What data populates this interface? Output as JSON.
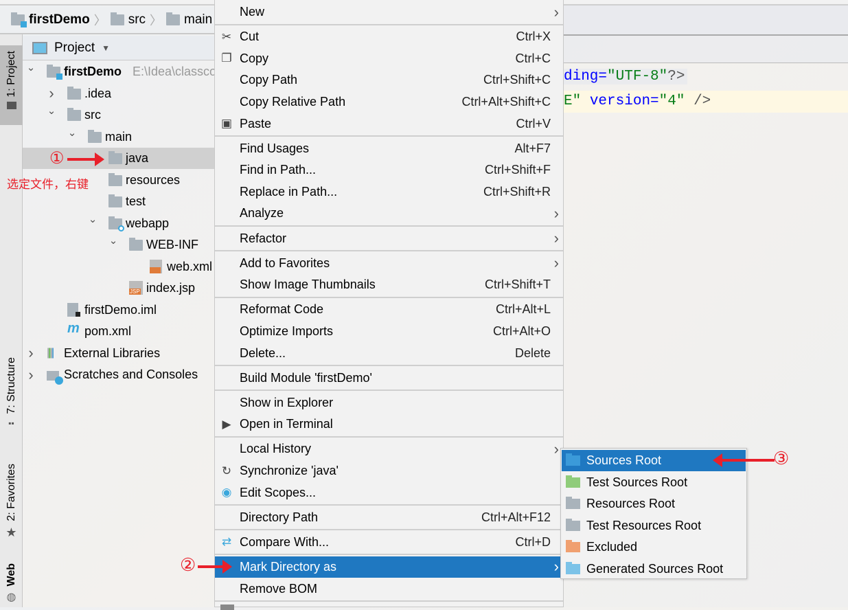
{
  "breadcrumb": {
    "items": [
      "firstDemo",
      "src",
      "main"
    ]
  },
  "tool_stripe": {
    "project": "1: Project",
    "structure": "7: Structure",
    "favorites": "2: Favorites",
    "web": "Web"
  },
  "project_panel": {
    "title": "Project",
    "tree": [
      {
        "label": "firstDemo",
        "hint": "E:\\Idea\\classco",
        "level": 0,
        "chevron": "down",
        "icon": "module-folder",
        "bold": true
      },
      {
        "label": ".idea",
        "level": 1,
        "chevron": "right",
        "icon": "folder"
      },
      {
        "label": "src",
        "level": 1,
        "chevron": "down",
        "icon": "folder"
      },
      {
        "label": "main",
        "level": 2,
        "chevron": "down",
        "icon": "folder"
      },
      {
        "label": "java",
        "level": 3,
        "icon": "folder",
        "selected": true
      },
      {
        "label": "resources",
        "level": 3,
        "icon": "folder"
      },
      {
        "label": "test",
        "level": 3,
        "icon": "folder"
      },
      {
        "label": "webapp",
        "level": 3,
        "chevron": "down",
        "icon": "web-folder"
      },
      {
        "label": "WEB-INF",
        "level": 4,
        "chevron": "down",
        "icon": "folder"
      },
      {
        "label": "web.xml",
        "level": 5,
        "icon": "xml-file"
      },
      {
        "label": "index.jsp",
        "level": 4,
        "icon": "jsp-file"
      },
      {
        "label": "firstDemo.iml",
        "level": 1,
        "icon": "iml-file"
      },
      {
        "label": "pom.xml",
        "level": 1,
        "icon": "maven-file"
      },
      {
        "label": "External Libraries",
        "level": 0,
        "chevron": "right",
        "icon": "library"
      },
      {
        "label": "Scratches and Consoles",
        "level": 0,
        "chevron": "right",
        "icon": "scratches"
      }
    ]
  },
  "editor": {
    "line1": {
      "attr": "ding",
      "eq": "=",
      "value": "\"UTF-8\"",
      "end": "?>"
    },
    "line2": {
      "prev": "E\"",
      "attr": "version",
      "eq": "=",
      "value": "\"4\"",
      "end": "/>"
    }
  },
  "context_menu": {
    "items": [
      {
        "label": "New",
        "submenu": true
      },
      {
        "sep": true
      },
      {
        "label": "Cut",
        "shortcut": "Ctrl+X",
        "icon": "scissors-icon"
      },
      {
        "label": "Copy",
        "shortcut": "Ctrl+C",
        "icon": "copy-icon"
      },
      {
        "label": "Copy Path",
        "shortcut": "Ctrl+Shift+C"
      },
      {
        "label": "Copy Relative Path",
        "shortcut": "Ctrl+Alt+Shift+C"
      },
      {
        "label": "Paste",
        "shortcut": "Ctrl+V",
        "icon": "paste-icon"
      },
      {
        "sep": true
      },
      {
        "label": "Find Usages",
        "shortcut": "Alt+F7"
      },
      {
        "label": "Find in Path...",
        "shortcut": "Ctrl+Shift+F"
      },
      {
        "label": "Replace in Path...",
        "shortcut": "Ctrl+Shift+R"
      },
      {
        "label": "Analyze",
        "submenu": true
      },
      {
        "sep": true
      },
      {
        "label": "Refactor",
        "submenu": true
      },
      {
        "sep": true
      },
      {
        "label": "Add to Favorites",
        "submenu": true
      },
      {
        "label": "Show Image Thumbnails",
        "shortcut": "Ctrl+Shift+T"
      },
      {
        "sep": true
      },
      {
        "label": "Reformat Code",
        "shortcut": "Ctrl+Alt+L"
      },
      {
        "label": "Optimize Imports",
        "shortcut": "Ctrl+Alt+O"
      },
      {
        "label": "Delete...",
        "shortcut": "Delete"
      },
      {
        "sep": true
      },
      {
        "label": "Build Module 'firstDemo'"
      },
      {
        "sep": true
      },
      {
        "label": "Show in Explorer"
      },
      {
        "label": "Open in Terminal",
        "icon": "terminal-icon"
      },
      {
        "sep": true
      },
      {
        "label": "Local History",
        "submenu": true
      },
      {
        "label": "Synchronize 'java'",
        "icon": "sync-icon"
      },
      {
        "label": "Edit Scopes...",
        "icon": "scope-icon"
      },
      {
        "sep": true
      },
      {
        "label": "Directory Path",
        "shortcut": "Ctrl+Alt+F12"
      },
      {
        "sep": true
      },
      {
        "label": "Compare With...",
        "shortcut": "Ctrl+D",
        "icon": "compare-icon"
      },
      {
        "sep": true
      },
      {
        "label": "Mark Directory as",
        "submenu": true,
        "highlighted": true
      },
      {
        "label": "Remove BOM"
      },
      {
        "sep": true
      }
    ]
  },
  "mark_directory_submenu": {
    "items": [
      {
        "label": "Sources Root",
        "color": "#3b9ad9",
        "highlighted": true
      },
      {
        "label": "Test Sources Root",
        "color": "#8fcc7a"
      },
      {
        "label": "Resources Root",
        "color": "#a9b3bb"
      },
      {
        "label": "Test Resources Root",
        "color": "#a9b3bb"
      },
      {
        "label": "Excluded",
        "color": "#f0a070"
      },
      {
        "label": "Generated Sources Root",
        "color": "#7cc3e8"
      }
    ]
  },
  "annotations": {
    "step1": "①",
    "step1_note": "选定文件，右键",
    "step2": "②",
    "step3": "③"
  },
  "colors": {
    "highlight": "#1f78c1",
    "annotation": "#e8202a"
  }
}
